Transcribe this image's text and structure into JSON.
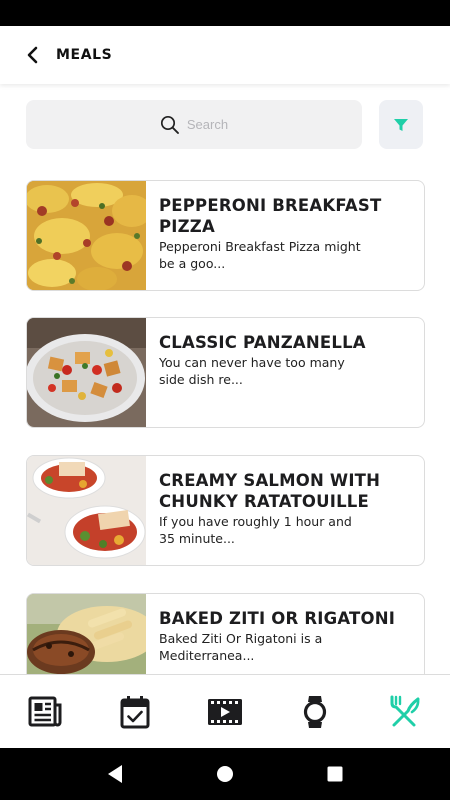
{
  "header": {
    "title": "MEALS",
    "back_icon": "chevron-left-icon"
  },
  "search": {
    "placeholder": "Search",
    "icon": "search-icon"
  },
  "filter": {
    "icon": "filter-icon",
    "color": "#1fcfa8"
  },
  "meals": [
    {
      "title": "PEPPERONI BREAKFAST PIZZA",
      "description": "Pepperoni Breakfast Pizza might be a goo..."
    },
    {
      "title": "CLASSIC PANZANELLA",
      "description": "You can never have too many side dish re..."
    },
    {
      "title": "CREAMY SALMON WITH CHUNKY RATATOUILLE",
      "description": "If you have roughly 1 hour and 35 minute..."
    },
    {
      "title": "BAKED ZITI OR RIGATONI",
      "description": "Baked Ziti Or Rigatoni is a Mediterranea..."
    }
  ],
  "bottom_nav": [
    {
      "icon": "newspaper-icon",
      "active": false
    },
    {
      "icon": "calendar-check-icon",
      "active": false
    },
    {
      "icon": "video-film-icon",
      "active": false
    },
    {
      "icon": "smartwatch-icon",
      "active": false
    },
    {
      "icon": "fork-knife-icon",
      "active": true
    }
  ],
  "colors": {
    "accent": "#1fcfa8",
    "icon_dark": "#1d1d1f"
  }
}
